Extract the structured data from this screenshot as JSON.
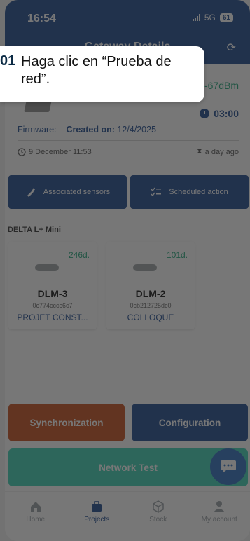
{
  "status_bar": {
    "time": "16:54",
    "network": "5G",
    "battery": "61"
  },
  "header": {
    "title": "Gateway Details"
  },
  "gateway": {
    "signal": "-67dBm",
    "timer": "03:00",
    "firmware_label": "Firmware:",
    "created_label": "Created on:",
    "created_date": "12/4/2025",
    "last_seen": "9 December 11:53",
    "relative_time": "a day ago"
  },
  "actions": {
    "associated_sensors": "Associated sensors",
    "scheduled_action": "Scheduled action"
  },
  "section": {
    "title": "DELTA L+ Mini"
  },
  "sensors": [
    {
      "days": "246d.",
      "name": "DLM-3",
      "id": "0c774cccc6c7",
      "project": "PROJET CONST..."
    },
    {
      "days": "101d.",
      "name": "DLM-2",
      "id": "0cb212725dc0",
      "project": "COLLOQUE"
    }
  ],
  "buttons": {
    "synchronization": "Synchronization",
    "configuration": "Configuration",
    "network_test": "Network Test"
  },
  "tabs": [
    {
      "label": "Home"
    },
    {
      "label": "Projects"
    },
    {
      "label": "Stock"
    },
    {
      "label": "My account"
    }
  ],
  "tooltip": {
    "step": "01",
    "text": "Haga clic en “Prueba de red”."
  },
  "colors": {
    "primary": "#1f4a8f",
    "accent": "#3ed1b5",
    "danger": "#c8501e",
    "success": "#21a67a"
  }
}
